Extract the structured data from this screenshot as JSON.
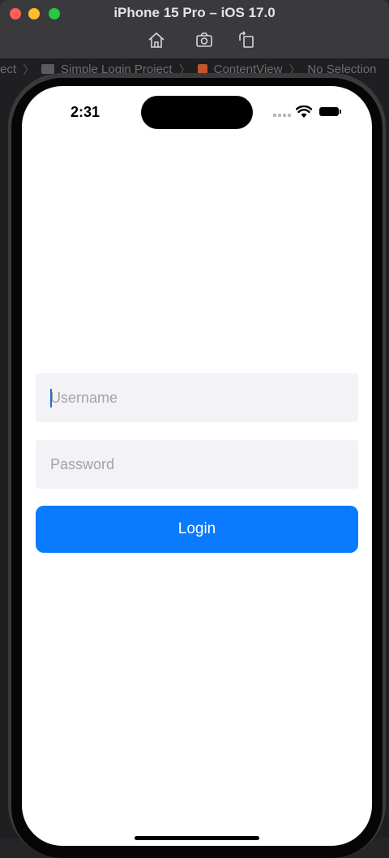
{
  "simulator": {
    "title": "iPhone 15 Pro – iOS 17.0",
    "toolbar": [
      {
        "name": "home-icon"
      },
      {
        "name": "screenshot-icon"
      },
      {
        "name": "rotate-icon"
      }
    ]
  },
  "xcode_background": {
    "breadcrumb": [
      "ect",
      "Simple Login Project",
      "ContentView",
      "No Selection"
    ]
  },
  "status_bar": {
    "time": "2:31"
  },
  "login_form": {
    "username_placeholder": "Username",
    "password_placeholder": "Password",
    "login_label": "Login"
  },
  "colors": {
    "accent": "#0A7AFF",
    "field_background": "#F2F2F7"
  }
}
